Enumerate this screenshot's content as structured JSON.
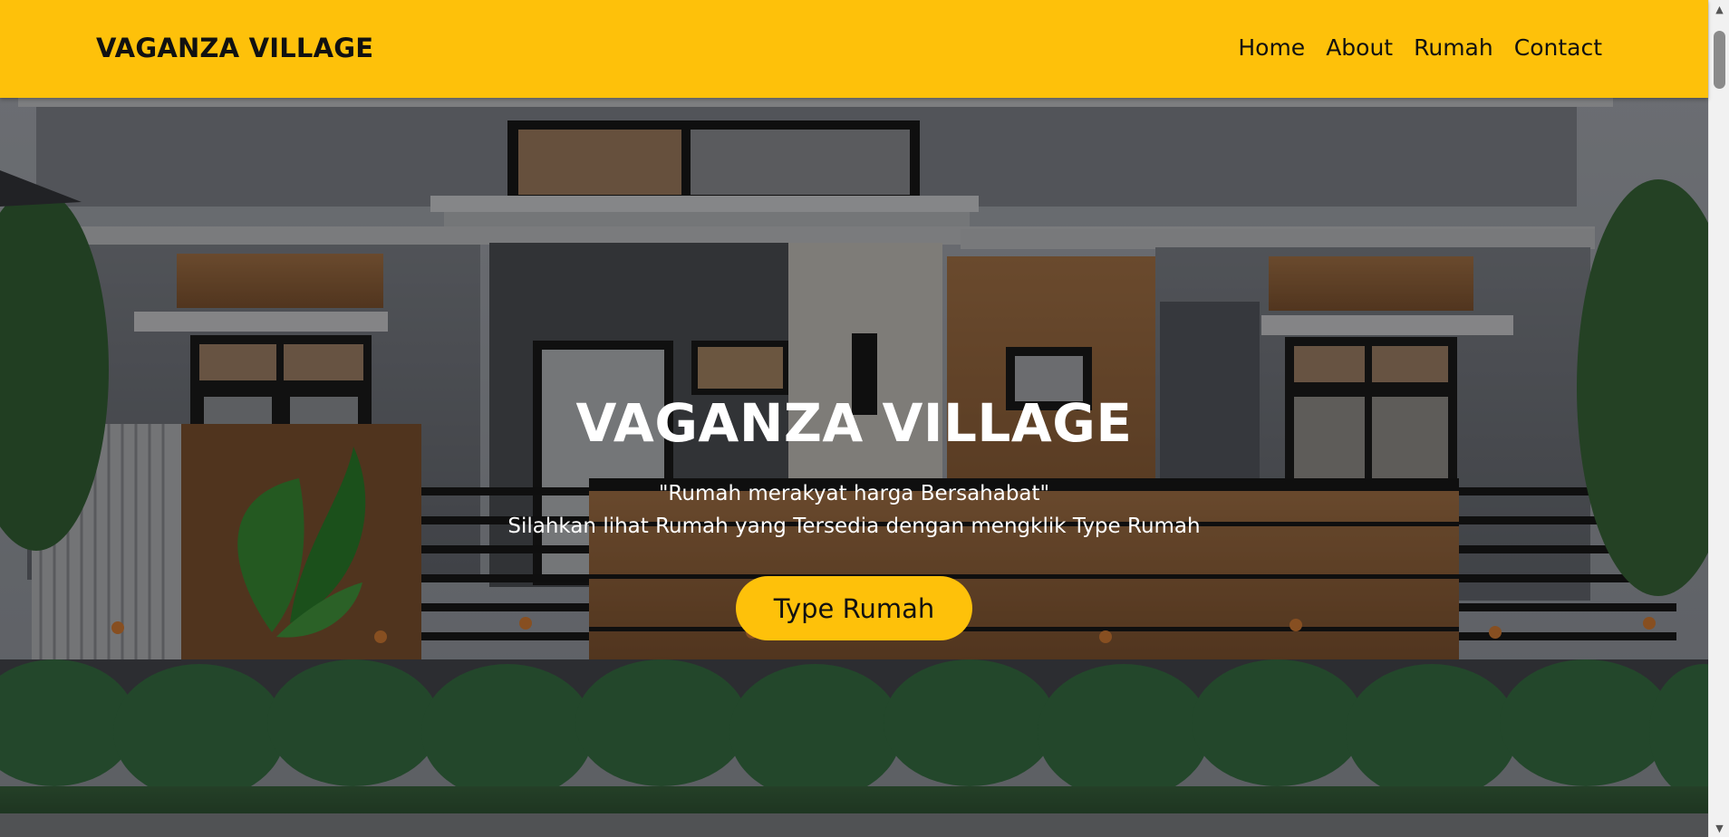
{
  "navbar": {
    "brand": "VAGANZA VILLAGE",
    "links": [
      {
        "label": "Home"
      },
      {
        "label": "About"
      },
      {
        "label": "Rumah"
      },
      {
        "label": "Contact"
      }
    ],
    "background_color": "#fec10a"
  },
  "hero": {
    "title": "VAGANZA VILLAGE",
    "tagline": "\"Rumah merakyat harga Bersahabat\"",
    "description": "Silahkan lihat Rumah yang Tersedia dengan mengklik Type Rumah",
    "cta_label": "Type Rumah",
    "cta_color": "#fec10a",
    "background_image": "house-facade-photo"
  },
  "scrollbar": {
    "up_icon": "chevron-up-icon",
    "down_icon": "chevron-down-icon"
  }
}
